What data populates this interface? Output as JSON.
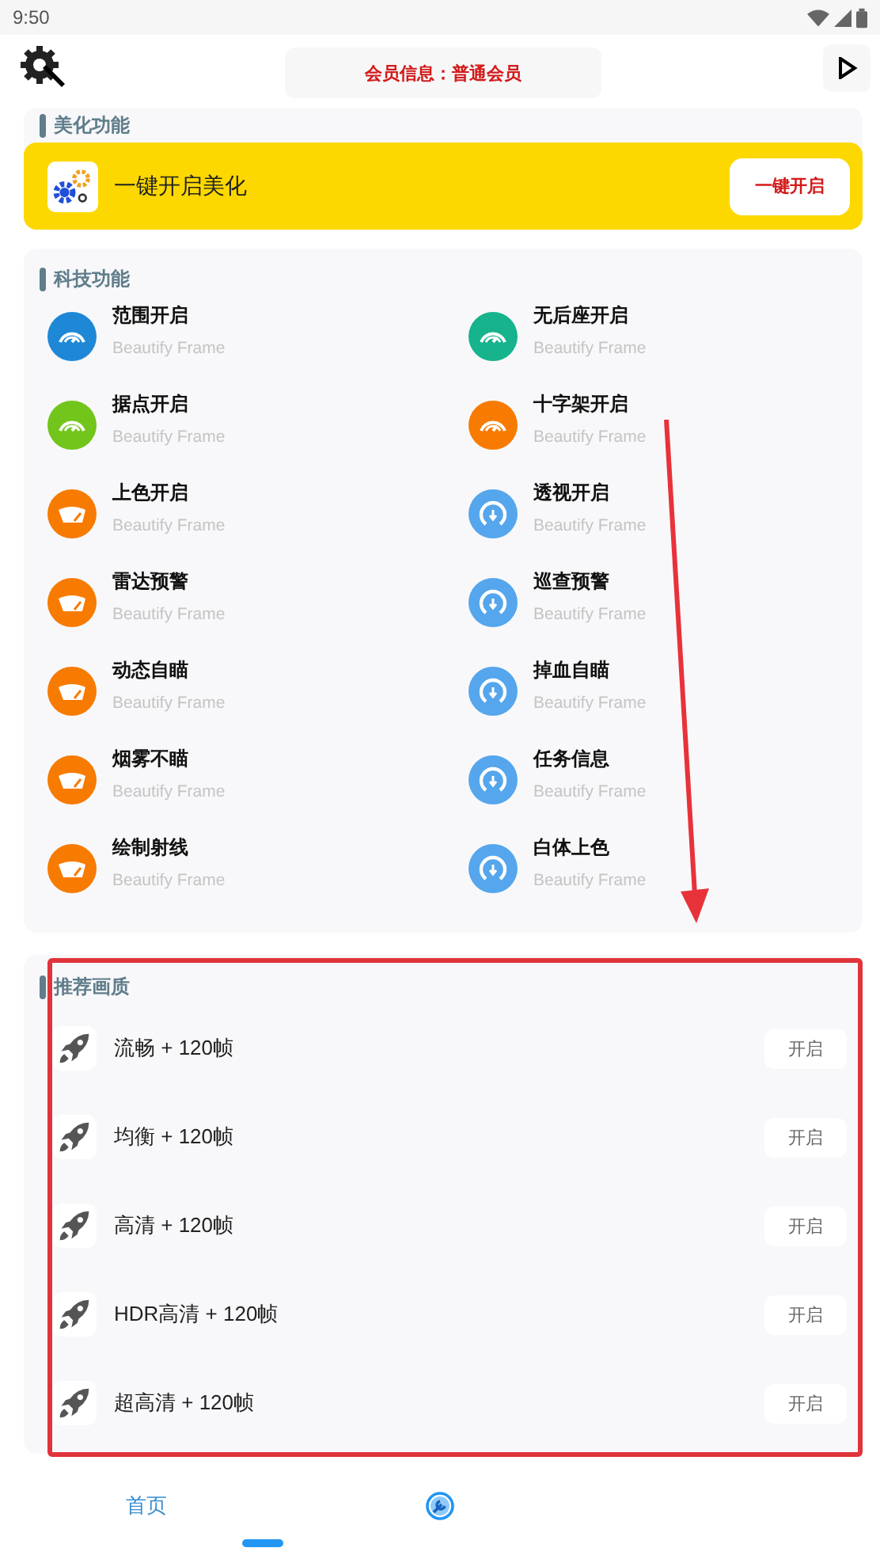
{
  "status_bar": {
    "time": "9:50"
  },
  "header": {
    "member_info": "会员信息：普通会员"
  },
  "beautify_section": {
    "title": "美化功能",
    "banner": {
      "label": "一键开启美化",
      "button": "一键开启"
    }
  },
  "tech_section": {
    "title": "科技功能",
    "items": [
      {
        "name": "范围开启",
        "subtitle": "Beautify Frame",
        "kind": "gauge",
        "color": "#1e88d6"
      },
      {
        "name": "无后座开启",
        "subtitle": "Beautify Frame",
        "kind": "gauge",
        "color": "#16b38c"
      },
      {
        "name": "据点开启",
        "subtitle": "Beautify Frame",
        "kind": "gauge",
        "color": "#72c51a"
      },
      {
        "name": "十字架开启",
        "subtitle": "Beautify Frame",
        "kind": "gauge",
        "color": "#f77b00"
      },
      {
        "name": "上色开启",
        "subtitle": "Beautify Frame",
        "kind": "meter",
        "color": "#f77b00"
      },
      {
        "name": "透视开启",
        "subtitle": "Beautify Frame",
        "kind": "dial",
        "color": "#55a6ec"
      },
      {
        "name": "雷达预警",
        "subtitle": "Beautify Frame",
        "kind": "meter",
        "color": "#f77b00"
      },
      {
        "name": "巡查预警",
        "subtitle": "Beautify Frame",
        "kind": "dial",
        "color": "#55a6ec"
      },
      {
        "name": "动态自瞄",
        "subtitle": "Beautify Frame",
        "kind": "meter",
        "color": "#f77b00"
      },
      {
        "name": "掉血自瞄",
        "subtitle": "Beautify Frame",
        "kind": "dial",
        "color": "#55a6ec"
      },
      {
        "name": "烟雾不瞄",
        "subtitle": "Beautify Frame",
        "kind": "meter",
        "color": "#f77b00"
      },
      {
        "name": "任务信息",
        "subtitle": "Beautify Frame",
        "kind": "dial",
        "color": "#55a6ec"
      },
      {
        "name": "绘制射线",
        "subtitle": "Beautify Frame",
        "kind": "meter",
        "color": "#f77b00"
      },
      {
        "name": "白体上色",
        "subtitle": "Beautify Frame",
        "kind": "dial",
        "color": "#55a6ec"
      }
    ]
  },
  "quality_section": {
    "title": "推荐画质",
    "presets": [
      {
        "label": "流畅 + 120帧",
        "button": "开启"
      },
      {
        "label": "均衡 + 120帧",
        "button": "开启"
      },
      {
        "label": "高清 + 120帧",
        "button": "开启"
      },
      {
        "label": "HDR高清 + 120帧",
        "button": "开启"
      },
      {
        "label": "超高清 + 120帧",
        "button": "开启"
      }
    ]
  },
  "bottom_nav": {
    "tabs": [
      {
        "kind": "text",
        "label": "首页",
        "selected": true
      },
      {
        "kind": "icon",
        "selected": false
      }
    ]
  }
}
